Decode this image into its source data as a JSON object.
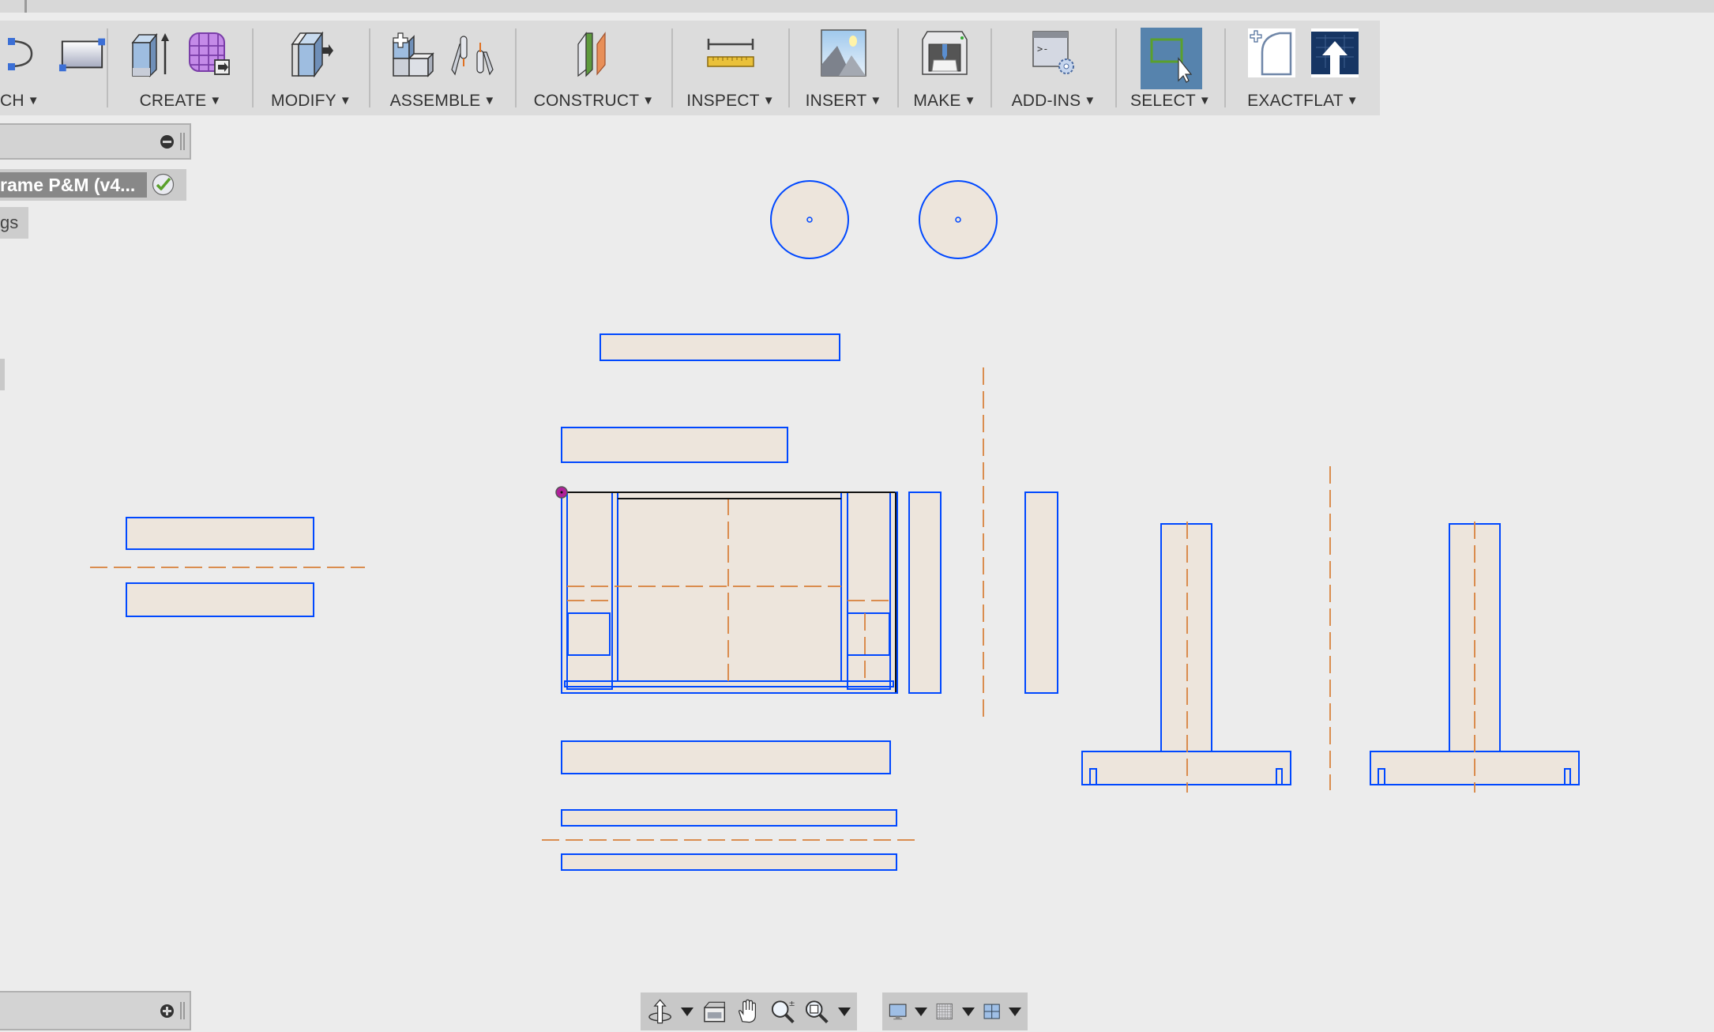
{
  "toolbar": {
    "groups": [
      {
        "label": "CH",
        "icons": [
          "sketch-arc-icon",
          "rectangle-sketch-icon"
        ]
      },
      {
        "label": "CREATE",
        "icons": [
          "extrude-icon",
          "form-icon"
        ]
      },
      {
        "label": "MODIFY",
        "icons": [
          "press-pull-icon"
        ]
      },
      {
        "label": "ASSEMBLE",
        "icons": [
          "new-component-icon",
          "joint-icon"
        ]
      },
      {
        "label": "CONSTRUCT",
        "icons": [
          "offset-plane-icon"
        ]
      },
      {
        "label": "INSPECT",
        "icons": [
          "measure-icon"
        ]
      },
      {
        "label": "INSERT",
        "icons": [
          "insert-image-icon"
        ]
      },
      {
        "label": "MAKE",
        "icons": [
          "3d-print-icon"
        ]
      },
      {
        "label": "ADD-INS",
        "icons": [
          "scripts-addins-icon"
        ]
      },
      {
        "label": "SELECT",
        "icons": [
          "window-select-icon"
        ],
        "active": true
      },
      {
        "label": "EXACTFLAT",
        "icons": [
          "exactflat-new-icon",
          "exactflat-upload-icon"
        ]
      }
    ],
    "caret": "▼"
  },
  "browser": {
    "document_name": "rame P&M (v4...",
    "folder_label": "gs"
  },
  "colors": {
    "sketch_line": "#0048ff",
    "construction_line": "#d9833f",
    "profile_fill": "#ede5dc",
    "canvas_bg": "#ececec",
    "select_active": "#5683ad",
    "origin_point": "#b0209a"
  },
  "navbar": {
    "left_tools": [
      "orbit-icon",
      "look-at-icon",
      "pan-icon",
      "zoom-icon",
      "fit-window-icon"
    ],
    "right_tools": [
      "display-settings-icon",
      "grid-settings-icon",
      "viewports-icon"
    ]
  }
}
